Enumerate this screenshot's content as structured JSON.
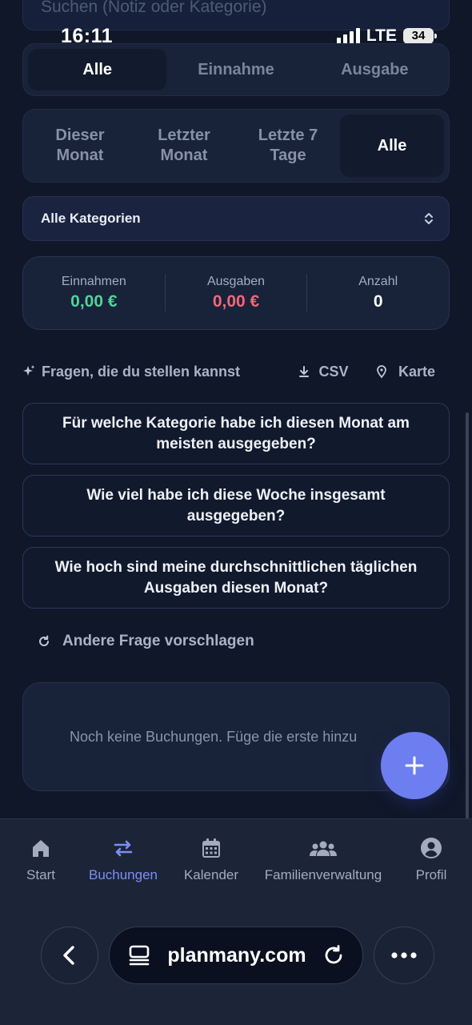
{
  "search": {
    "placeholder": "Suchen (Notiz oder Kategorie)"
  },
  "status_bar": {
    "time": "16:11",
    "network": "LTE",
    "battery": "34"
  },
  "type_filter": {
    "options": [
      "Alle",
      "Einnahme",
      "Ausgabe"
    ],
    "selected": "Alle"
  },
  "period_filter": {
    "options": [
      "Dieser\nMonat",
      "Letzter\nMonat",
      "Letzte 7\nTage",
      "Alle"
    ],
    "selected": "Alle"
  },
  "category_select": {
    "value": "Alle Kategorien"
  },
  "stats": {
    "income": {
      "label": "Einnahmen",
      "value": "0,00 €"
    },
    "expenses": {
      "label": "Ausgaben",
      "value": "0,00 €"
    },
    "count": {
      "label": "Anzahl",
      "value": "0"
    }
  },
  "actions": {
    "questions": "Fragen, die du stellen kannst",
    "csv": "CSV",
    "map": "Karte"
  },
  "questions": [
    "Für welche Kategorie habe ich diesen Monat am meisten ausgegeben?",
    "Wie viel habe ich diese Woche insgesamt ausgegeben?",
    "Wie hoch sind meine durchschnittlichen täglichen Ausgaben diesen Monat?"
  ],
  "suggest_other": "Andere Frage vorschlagen",
  "empty_state": "Noch keine Buchungen. Füge die erste hinzu",
  "nav": [
    {
      "label": "Start",
      "icon": "home-icon"
    },
    {
      "label": "Buchungen",
      "icon": "transfer-arrows-icon",
      "active": true
    },
    {
      "label": "Kalender",
      "icon": "calendar-icon"
    },
    {
      "label": "Familienverwaltung",
      "icon": "group-icon"
    },
    {
      "label": "Profil",
      "icon": "user-circle-icon"
    }
  ],
  "browser": {
    "url": "planmany.com"
  },
  "colors": {
    "accent": "#6d7ef0",
    "income": "#4fd49a",
    "expense": "#f0687a",
    "background": "#0f1729"
  }
}
